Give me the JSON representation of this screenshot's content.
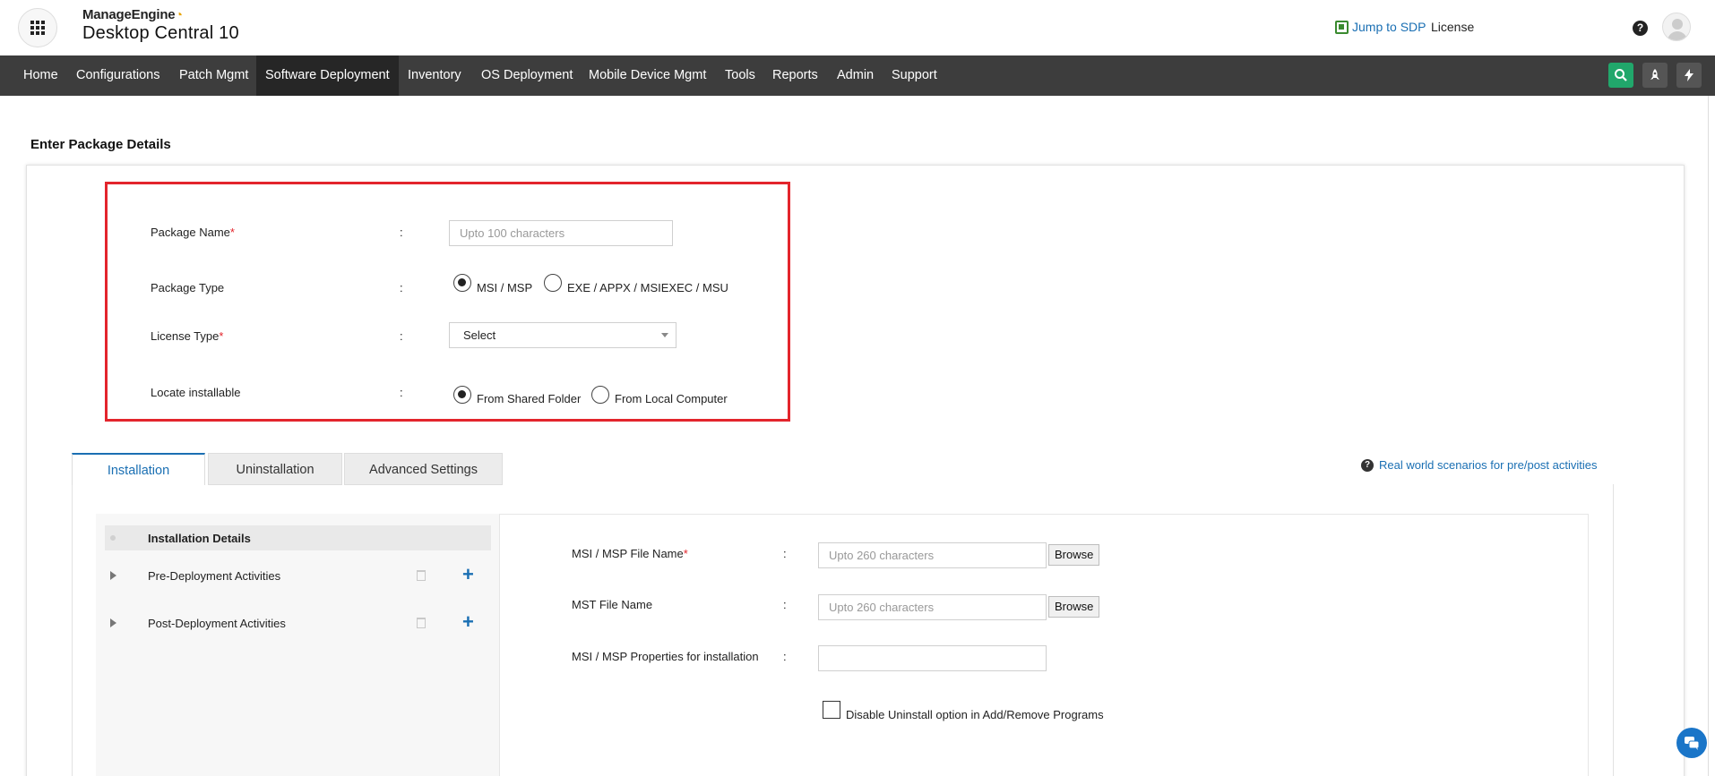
{
  "header": {
    "brand_top": "ManageEngine",
    "brand_product": "Desktop Central 10",
    "jump_to_sdp": "Jump to SDP",
    "license": "License",
    "help_glyph": "?"
  },
  "nav": {
    "items": [
      "Home",
      "Configurations",
      "Patch Mgmt",
      "Software Deployment",
      "Inventory",
      "OS Deployment",
      "Mobile Device Mgmt",
      "Tools",
      "Reports",
      "Admin",
      "Support"
    ],
    "active": "Software Deployment",
    "icons": [
      "search-icon",
      "rocket-icon",
      "lightning-icon"
    ]
  },
  "page": {
    "title": "Enter Package Details"
  },
  "form": {
    "package_name_label": "Package Name",
    "package_name_placeholder": "Upto 100 characters",
    "package_type_label": "Package Type",
    "package_type_options": [
      "MSI / MSP",
      "EXE / APPX / MSIEXEC / MSU"
    ],
    "package_type_selected": "MSI / MSP",
    "license_type_label": "License Type",
    "license_type_value": "Select",
    "locate_label": "Locate installable",
    "locate_options": [
      "From Shared Folder",
      "From Local Computer"
    ],
    "locate_selected": "From Shared Folder",
    "colon": ":",
    "required_mark": "*"
  },
  "tabs": {
    "items": [
      "Installation",
      "Uninstallation",
      "Advanced Settings"
    ],
    "active": "Installation",
    "help_link": "Real world scenarios for pre/post activities"
  },
  "installation": {
    "tree": {
      "header": "Installation Details",
      "items": [
        "Pre-Deployment Activities",
        "Post-Deployment Activities"
      ]
    },
    "msi_file_label": "MSI / MSP File Name",
    "msi_file_placeholder": "Upto 260 characters",
    "mst_file_label": "MST File Name",
    "mst_file_placeholder": "Upto 260 characters",
    "properties_label": "MSI / MSP Properties for installation",
    "properties_value": "",
    "browse_label": "Browse",
    "disable_uninstall_label": "Disable Uninstall option in Add/Remove Programs",
    "disable_uninstall_checked": false
  },
  "colors": {
    "nav_bg": "#3d3d3d",
    "nav_active_bg": "#262626",
    "link_blue": "#1a6fb3",
    "highlight_red": "#e3252c",
    "search_green": "#21a76b"
  }
}
